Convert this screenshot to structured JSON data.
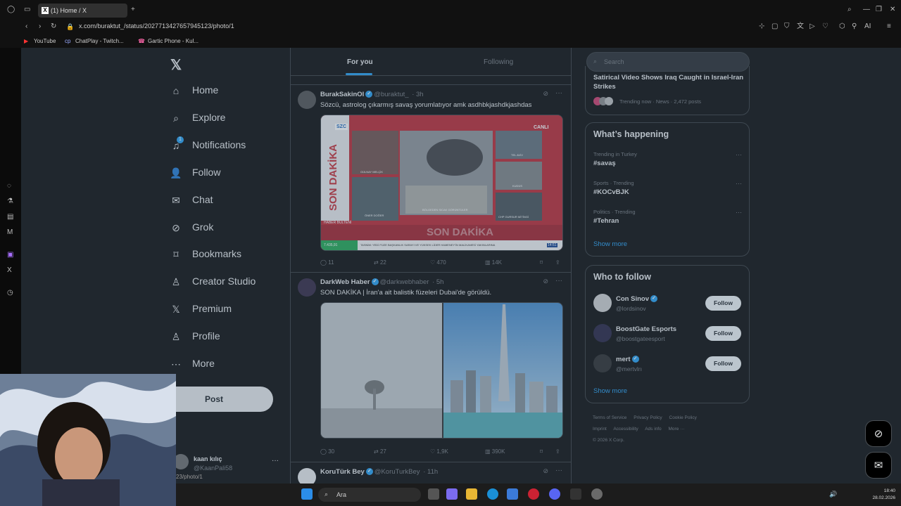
{
  "browser": {
    "tab_title": "(1) Home / X",
    "url": "x.com/buraktut_/status/2027713427657945123/photo/1",
    "bookmarks": [
      {
        "label": "YouTube"
      },
      {
        "label": "ChatPlay - Twitch..."
      },
      {
        "label": "Gartic Phone - Kul..."
      }
    ]
  },
  "nav": {
    "items": [
      {
        "label": "Home",
        "icon": "home-icon"
      },
      {
        "label": "Explore",
        "icon": "search-icon"
      },
      {
        "label": "Notifications",
        "icon": "bell-icon",
        "badge": "1"
      },
      {
        "label": "Follow",
        "icon": "add-user-icon"
      },
      {
        "label": "Chat",
        "icon": "mail-icon"
      },
      {
        "label": "Grok",
        "icon": "grok-icon"
      },
      {
        "label": "Bookmarks",
        "icon": "bookmark-icon"
      },
      {
        "label": "Creator Studio",
        "icon": "creator-icon"
      },
      {
        "label": "Premium",
        "icon": "x-icon"
      },
      {
        "label": "Profile",
        "icon": "person-icon"
      },
      {
        "label": "More",
        "icon": "more-circle-icon"
      }
    ],
    "post_label": "Post",
    "account": {
      "name": "kaan kılıç",
      "handle": "@KaanPali58"
    },
    "status_link": "23/photo/1"
  },
  "feed": {
    "tabs": [
      {
        "label": "For you"
      },
      {
        "label": "Following"
      }
    ],
    "tweets": [
      {
        "name": "BurakSakinOl",
        "handle": "@buraktut_",
        "time": "· 3h",
        "text": "Sözcü, astrolog çıkarmış savaş yorumlatıyor amk asdhbkjashdkjashdas",
        "media": {
          "channel": "SZC",
          "live": "CANLI",
          "headline_vertical": "SON DAKİKA",
          "headline_band": "SON DAKİKA",
          "bulletin": "HABER BÜLTENİ",
          "ticker_value": "7.435,91",
          "ticker": "TASNİM: YEDİ FÜZE BAŞKANLIK SARAYI VE YÜKSEK LİDER HAMENEY'İN MALİKANESİ YAKINLARINA",
          "time": "14:51",
          "person1": "GÜLNAY MELÇİK",
          "person2": "ÖNER DOĞER",
          "center_caption": "BÖLGEDEN SICAK GÖRÜNTÜLER",
          "side_captions": [
            "TEL AVİV",
            "KUDÜS",
            "CHP GURSUR MİTİNGİ"
          ]
        },
        "replies": "11",
        "reposts": "22",
        "likes": "470",
        "views": "14K"
      },
      {
        "name": "DarkWeb Haber",
        "handle": "@darkwebhaber",
        "time": "· 5h",
        "text": "SON DAKİKA | İran'a ait balistik füzeleri Dubai'de görüldü.",
        "replies": "30",
        "reposts": "27",
        "likes": "1,9K",
        "views": "390K"
      },
      {
        "name": "KoruTürk Bey",
        "handle": "@KoruTurkBey",
        "time": "· 11h",
        "text": ""
      }
    ]
  },
  "sidebar": {
    "search_placeholder": "Search",
    "top_trend": {
      "title": "Satirical Video Shows Iraq Caught in Israel-Iran Strikes",
      "meta": "Trending now · News · 2,472 posts"
    },
    "happening_title": "What’s happening",
    "trends": [
      {
        "meta": "Trending in Turkey",
        "tag": "#savaş"
      },
      {
        "meta": "Sports · Trending",
        "tag": "#KOCvBJK"
      },
      {
        "meta": "Politics · Trending",
        "tag": "#Tehran"
      }
    ],
    "show_more": "Show more",
    "who_to_follow_title": "Who to follow",
    "follow": [
      {
        "name": "Con Sinov",
        "handle": "@lordsinov",
        "verified": true,
        "button": "Follow"
      },
      {
        "name": "BoostGate Esports",
        "handle": "@boostgateesport",
        "verified": false,
        "button": "Follow"
      },
      {
        "name": "mert",
        "handle": "@mertvlrı",
        "verified": true,
        "button": "Follow"
      }
    ],
    "show_more_2": "Show more",
    "footer": [
      "Terms of Service",
      "Privacy Policy",
      "Cookie Policy",
      "Imprint",
      "Accessibility",
      "Ads info",
      "More ···",
      "© 2026 X Corp."
    ]
  },
  "taskbar": {
    "search_label": "Ara",
    "time": "18:40",
    "date": "28.02.2026"
  },
  "colors": {
    "accent": "#1d9bf0",
    "background": "#000000",
    "border": "#2f3336",
    "muted": "#71767b"
  }
}
